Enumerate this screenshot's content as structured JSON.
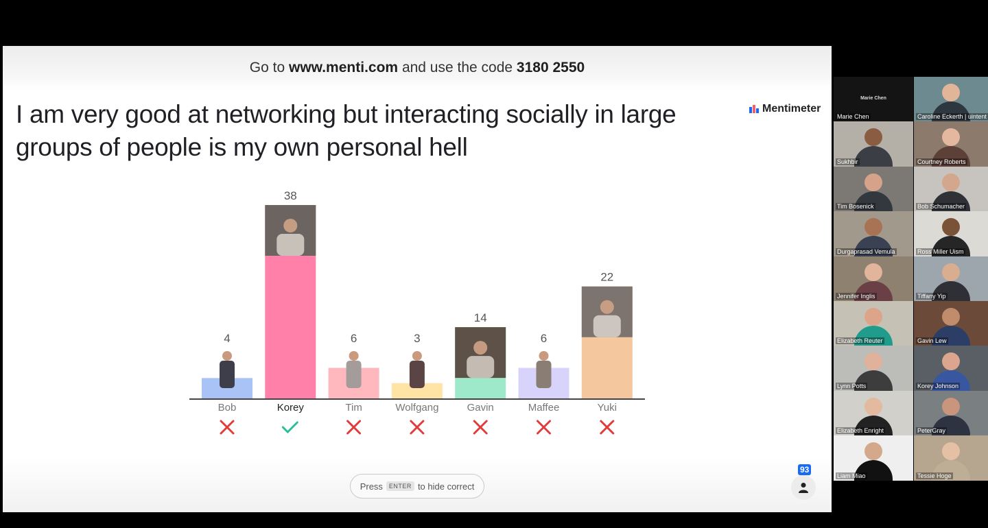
{
  "banner": {
    "prefix": "Go to",
    "url": "www.menti.com",
    "middle": "and use the code",
    "code": "3180 2550"
  },
  "question": "I am very good at networking but interacting socially in large groups of people is my own personal hell",
  "brand": {
    "name": "Mentimeter"
  },
  "chart_data": {
    "type": "bar",
    "categories": [
      "Bob",
      "Korey",
      "Tim",
      "Wolfgang",
      "Gavin",
      "Maffee",
      "Yuki"
    ],
    "values": [
      4,
      38,
      6,
      3,
      14,
      6,
      22
    ],
    "correct": [
      false,
      true,
      false,
      false,
      false,
      false,
      false
    ],
    "colors": [
      "#a9c3f6",
      "#ff80a8",
      "#ffb8bd",
      "#ffe4a6",
      "#9ee9c9",
      "#d7d3fa",
      "#f4c79e"
    ],
    "photo_colors": [
      "#3e3d4a",
      "#6c6460",
      "#a49b9b",
      "#5b4444",
      "#5e5248",
      "#8a7d73",
      "#7d7470"
    ],
    "title": "",
    "xlabel": "",
    "ylabel": "",
    "ylim": [
      0,
      38
    ],
    "grid": false
  },
  "hint": {
    "press": "Press",
    "key": "ENTER",
    "action": "to hide correct"
  },
  "participants": {
    "count": "93"
  },
  "video_tiles": [
    {
      "name": "Marie Chen",
      "bg": "#141414",
      "skin": "#141414",
      "shirt": "#141414",
      "center": "Marie Chen"
    },
    {
      "name": "Caroline Eckerth | uintent",
      "bg": "#6d8a91",
      "skin": "#e1b598",
      "shirt": "#2e3640"
    },
    {
      "name": "Sukhbir",
      "bg": "#b4b0a8",
      "skin": "#8a5d43",
      "shirt": "#3b3e44"
    },
    {
      "name": "Courtney Roberts",
      "bg": "#8c7a6c",
      "skin": "#e4b89e",
      "shirt": "#5d4037"
    },
    {
      "name": "Tim Bosenick",
      "bg": "#7c7874",
      "skin": "#d6a28a",
      "shirt": "#33383f"
    },
    {
      "name": "Bob Schumacher",
      "bg": "#c7c4bf",
      "skin": "#d3a68e",
      "shirt": "#2f3136"
    },
    {
      "name": "Durgaprasad Vemula",
      "bg": "#a2998d",
      "skin": "#a87355",
      "shirt": "#394152"
    },
    {
      "name": "Ross Miller Uism",
      "bg": "#dcdad5",
      "skin": "#7a5238",
      "shirt": "#262626"
    },
    {
      "name": "Jennifer Inglis",
      "bg": "#8f8170",
      "skin": "#e2b49b",
      "shirt": "#6b3f46"
    },
    {
      "name": "Tiffany Yip",
      "bg": "#9da5ad",
      "skin": "#d9ad90",
      "shirt": "#2f2f36"
    },
    {
      "name": "Elizabeth Reuter",
      "bg": "#c6c1b5",
      "skin": "#dca58a",
      "shirt": "#1f9c8c"
    },
    {
      "name": "Gavin Lew",
      "bg": "#6b4a3a",
      "skin": "#c18c6c",
      "shirt": "#2c3e66"
    },
    {
      "name": "Lynn Potts",
      "bg": "#bcbcb8",
      "skin": "#e0b29b",
      "shirt": "#3d3d3d"
    },
    {
      "name": "Korey Johnson",
      "bg": "#5a5f66",
      "skin": "#dba58f",
      "shirt": "#3957a1"
    },
    {
      "name": "Elizabeth Enright",
      "bg": "#d2d0cb",
      "skin": "#e3b9a0",
      "shirt": "#222222"
    },
    {
      "name": "PeterGray",
      "bg": "#7a7f82",
      "skin": "#c9957c",
      "shirt": "#2d3340"
    },
    {
      "name": "Liam Miao",
      "bg": "#efefef",
      "skin": "#d4a88b",
      "shirt": "#111111"
    },
    {
      "name": "Tessie Hoge",
      "bg": "#b6a58f",
      "skin": "#e6c0a4",
      "shirt": "#bfae96"
    }
  ]
}
